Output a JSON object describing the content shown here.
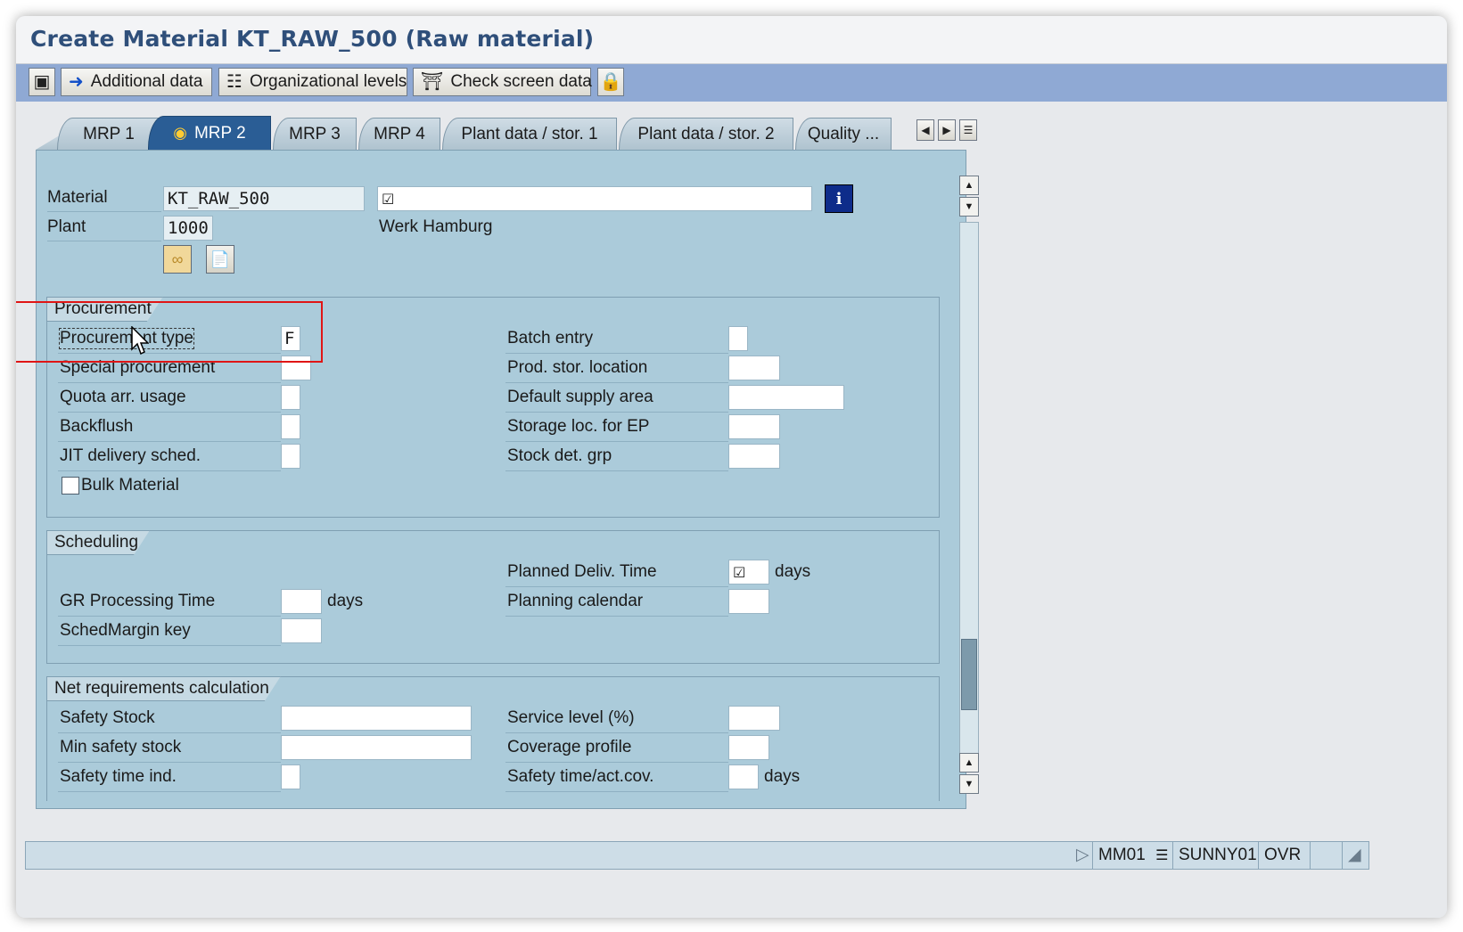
{
  "window": {
    "title": "Create Material KT_RAW_500 (Raw material)"
  },
  "toolbar": {
    "additional_data": "Additional data",
    "org_levels": "Organizational levels",
    "check_screen": "Check screen data"
  },
  "tabs": [
    {
      "label": "MRP 1",
      "active": false
    },
    {
      "label": "MRP 2",
      "active": true
    },
    {
      "label": "MRP 3",
      "active": false
    },
    {
      "label": "MRP 4",
      "active": false
    },
    {
      "label": "Plant data / stor. 1",
      "active": false
    },
    {
      "label": "Plant data / stor. 2",
      "active": false
    },
    {
      "label": "Quality ...",
      "active": false
    }
  ],
  "header": {
    "material_label": "Material",
    "material_value": "KT_RAW_500",
    "description_value": "",
    "plant_label": "Plant",
    "plant_value": "1000",
    "plant_name": "Werk Hamburg"
  },
  "procurement": {
    "title": "Procurement",
    "procurement_type_label": "Procurement type",
    "procurement_type_value": "F",
    "special_procurement_label": "Special procurement",
    "quota_label": "Quota arr. usage",
    "backflush_label": "Backflush",
    "jit_label": "JIT delivery sched.",
    "bulk_label": "Bulk Material",
    "batch_entry_label": "Batch entry",
    "prod_stor_label": "Prod. stor. location",
    "default_supply_label": "Default supply area",
    "storage_ep_label": "Storage loc. for EP",
    "stock_det_label": "Stock det. grp"
  },
  "scheduling": {
    "title": "Scheduling",
    "planned_deliv_label": "Planned Deliv. Time",
    "planned_deliv_unit": "days",
    "gr_time_label": "GR Processing Time",
    "gr_time_unit": "days",
    "planning_cal_label": "Planning calendar",
    "schedmargin_label": "SchedMargin key"
  },
  "netreq": {
    "title": "Net requirements calculation",
    "safety_stock_label": "Safety Stock",
    "service_level_label": "Service level (%)",
    "min_safety_label": "Min safety stock",
    "coverage_label": "Coverage profile",
    "safety_time_ind_label": "Safety time ind.",
    "safety_time_cov_label": "Safety time/act.cov.",
    "safety_time_cov_unit": "days"
  },
  "status": {
    "transaction": "MM01",
    "user": "SUNNY01",
    "mode": "OVR"
  },
  "colors": {
    "accent": "#2a5d95",
    "screen_bg": "#abcbda",
    "annotation": "#e01515"
  }
}
